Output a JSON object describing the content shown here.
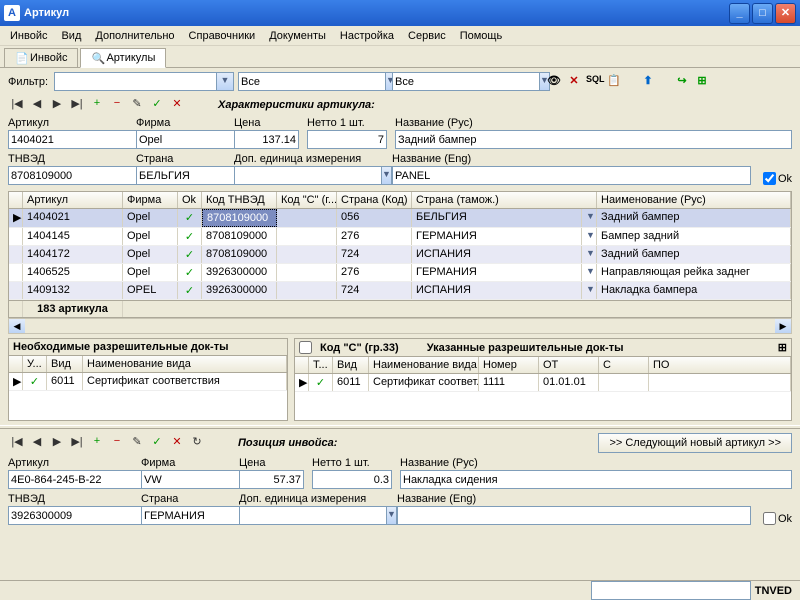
{
  "window": {
    "title": "Артикул"
  },
  "menu": [
    "Инвойс",
    "Вид",
    "Дополнительно",
    "Справочники",
    "Документы",
    "Настройка",
    "Сервис",
    "Помощь"
  ],
  "tabs": {
    "invoice": "Инвойс",
    "articles": "Артикулы"
  },
  "filter": {
    "label": "Фильтр:",
    "all1": "Все",
    "all2": "Все"
  },
  "toolbar_hints": {
    "find": "🔍",
    "del": "✕",
    "sql": "SQL"
  },
  "top": {
    "section": "Характеристики артикула:",
    "artikul_lbl": "Артикул",
    "artikul": "1404021",
    "firma_lbl": "Фирма",
    "firma": "Opel",
    "cena_lbl": "Цена",
    "cena": "137.14",
    "netto_lbl": "Нетто 1 шт.",
    "netto": "7",
    "name_rus_lbl": "Название (Рус)",
    "name_rus": "Задний бампер",
    "tnved_lbl": "ТНВЭД",
    "tnved": "8708109000",
    "strana_lbl": "Страна",
    "strana": "БЕЛЬГИЯ",
    "dop_lbl": "Доп. единица измерения",
    "dop": "",
    "name_eng_lbl": "Название (Eng)",
    "name_eng": "PANEL",
    "ok": "Ok"
  },
  "grid": {
    "headers": {
      "artikul": "Артикул",
      "firma": "Фирма",
      "ok": "Ok",
      "tnved": "Код ТНВЭД",
      "kodc": "Код \"С\" (г...",
      "strkod": "Страна (Код)",
      "strtam": "Страна (тамож.)",
      "naim": "Наименование (Рус)"
    },
    "rows": [
      {
        "mark": "▶",
        "artikul": "1404021",
        "firma": "Opel",
        "ok": true,
        "tnved": "8708109000",
        "kodc": "",
        "strkod": "056",
        "strtam": "БЕЛЬГИЯ",
        "naim": "Задний бампер",
        "sel": true,
        "tnved_sel": true
      },
      {
        "mark": "",
        "artikul": "1404145",
        "firma": "Opel",
        "ok": true,
        "tnved": "8708109000",
        "kodc": "",
        "strkod": "276",
        "strtam": "ГЕРМАНИЯ",
        "naim": "Бампер задний"
      },
      {
        "mark": "",
        "artikul": "1404172",
        "firma": "Opel",
        "ok": true,
        "tnved": "8708109000",
        "kodc": "",
        "strkod": "724",
        "strtam": "ИСПАНИЯ",
        "naim": "Задний бампер",
        "alt": true
      },
      {
        "mark": "",
        "artikul": "1406525",
        "firma": "Opel",
        "ok": true,
        "tnved": "3926300000",
        "kodc": "",
        "strkod": "276",
        "strtam": "ГЕРМАНИЯ",
        "naim": "Направляющая рейка заднег"
      },
      {
        "mark": "",
        "artikul": "1409132",
        "firma": "OPEL",
        "ok": true,
        "tnved": "3926300000",
        "kodc": "",
        "strkod": "724",
        "strtam": "ИСПАНИЯ",
        "naim": "Накладка бампера",
        "alt": true
      }
    ],
    "footer": "183 артикула"
  },
  "req": {
    "title": "Необходимые разрешительные док-ты",
    "headers": {
      "u": "У...",
      "vid": "Вид",
      "naim": "Наименование вида"
    },
    "row": {
      "vid": "6011",
      "naim": "Сертификат соответствия"
    }
  },
  "spec": {
    "title": "Указанные разрешительные док-ты",
    "kodc": "Код \"С\" (гр.33)",
    "headers": {
      "t": "Т...",
      "vid": "Вид",
      "naim": "Наименование вида",
      "nomer": "Номер",
      "ot": "ОТ",
      "s": "С",
      "po": "ПО"
    },
    "row": {
      "vid": "6011",
      "naim": "Сертификат соответ...",
      "nomer": "1111",
      "ot": "01.01.01"
    }
  },
  "bottom": {
    "section": "Позиция инвойса:",
    "next": ">> Следующий новый артикул >>",
    "artikul_lbl": "Артикул",
    "artikul": "4E0-864-245-B-22",
    "firma_lbl": "Фирма",
    "firma": "VW",
    "cena_lbl": "Цена",
    "cena": "57.37",
    "netto_lbl": "Нетто 1 шт.",
    "netto": "0.3",
    "name_rus_lbl": "Название (Рус)",
    "name_rus": "Накладка сидения",
    "tnved_lbl": "ТНВЭД",
    "tnved": "3926300009",
    "strana_lbl": "Страна",
    "strana": "ГЕРМАНИЯ",
    "dop_lbl": "Доп. единица измерения",
    "dop": "",
    "name_eng_lbl": "Название (Eng)",
    "name_eng": "",
    "ok": "Ok"
  },
  "status": {
    "tnved": "TNVED"
  }
}
